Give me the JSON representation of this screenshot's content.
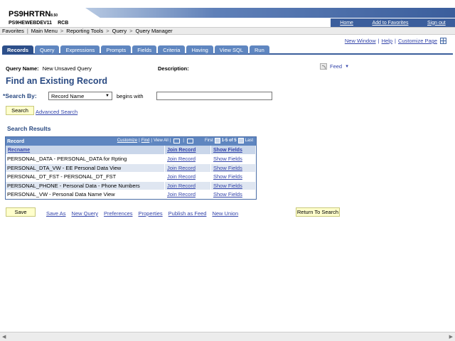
{
  "header": {
    "app_name": "PS9HRTRN",
    "version": "8.50",
    "database": "PS9HEWEBDEV11",
    "user": "RCB",
    "links": [
      "Home",
      "Add to Favorites",
      "Sign out"
    ]
  },
  "breadcrumb": [
    "Favorites",
    "Main Menu",
    "Reporting Tools",
    "Query",
    "Query Manager"
  ],
  "top_links": {
    "new_window": "New Window",
    "help": "Help",
    "customize": "Customize Page"
  },
  "tabs": [
    "Records",
    "Query",
    "Expressions",
    "Prompts",
    "Fields",
    "Criteria",
    "Having",
    "View SQL",
    "Run"
  ],
  "query": {
    "name_label": "Query Name:",
    "name_value": "New Unsaved Query",
    "description_label": "Description:",
    "feed_label": "Feed"
  },
  "page_title": "Find an Existing Record",
  "search": {
    "required_mark": "*",
    "label": "Search By:",
    "selected": "Record Name",
    "operator": "begins with",
    "value": "",
    "button": "Search",
    "advanced": "Advanced Search"
  },
  "results": {
    "title": "Search Results",
    "grid_title": "Record",
    "customize": "Customize",
    "find": "Find",
    "view_all": "View All",
    "first": "First",
    "range": "1-5 of 5",
    "last": "Last",
    "columns": [
      "Recname",
      "Join Record",
      "Show Fields"
    ],
    "rows": [
      {
        "recname": "PERSONAL_DATA - PERSONAL_DATA for Rpting",
        "join": "Join Record",
        "show": "Show Fields"
      },
      {
        "recname": "PERSONAL_DTA_VW - EE Personal Data View",
        "join": "Join Record",
        "show": "Show Fields"
      },
      {
        "recname": "PERSONAL_DT_FST - PERSONAL_DT_FST",
        "join": "Join Record",
        "show": "Show Fields"
      },
      {
        "recname": "PERSONAL_PHONE - Personal Data - Phone Numbers",
        "join": "Join Record",
        "show": "Show Fields"
      },
      {
        "recname": "PERSONAL_VW - Personal Data Name View",
        "join": "Join Record",
        "show": "Show Fields"
      }
    ]
  },
  "actions": {
    "save": "Save",
    "links": [
      "Save As",
      "New Query",
      "Preferences",
      "Properties",
      "Publish as Feed",
      "New Union"
    ],
    "return": "Return To Search"
  },
  "icons": {
    "grid_icon": "grid-icon",
    "feed_icon": "rss-feed-icon",
    "download_icon": "download-icon",
    "chart_icon": "chart-icon"
  }
}
